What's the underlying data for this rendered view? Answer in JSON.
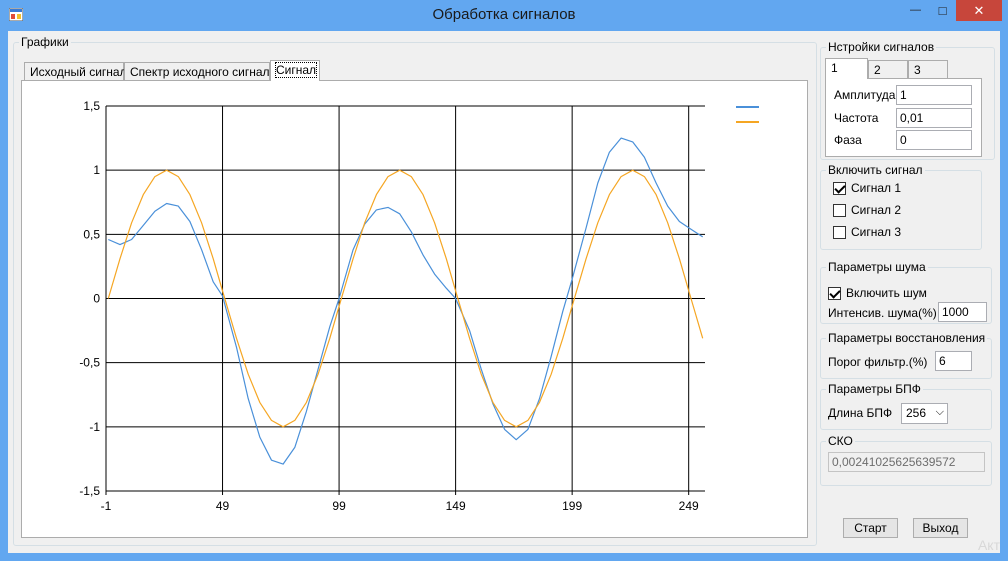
{
  "window": {
    "title": "Обработка сигналов",
    "close_glyph": "✕",
    "minimize_glyph": "—",
    "maximize_glyph": "□"
  },
  "graphs": {
    "group_label": "Графики",
    "tabs": [
      {
        "label": "Исходный сигнал"
      },
      {
        "label": "Спектр исходного сигнала"
      },
      {
        "label": "Сигнал"
      }
    ],
    "active_tab": "Сигнал"
  },
  "signal_settings": {
    "group_label": "Нстройки сигналов",
    "tabs": [
      {
        "label": "1"
      },
      {
        "label": "2"
      },
      {
        "label": "3"
      }
    ],
    "active_tab": "1",
    "amplitude_label": "Амплитуда",
    "amplitude_value": "1",
    "frequency_label": "Частота",
    "frequency_value": "0,01",
    "phase_label": "Фаза",
    "phase_value": "0"
  },
  "enable_signal": {
    "group_label": "Включить сигнал",
    "items": [
      {
        "label": "Сигнал 1",
        "checked": true
      },
      {
        "label": "Сигнал 2",
        "checked": false
      },
      {
        "label": "Сигнал 3",
        "checked": false
      }
    ]
  },
  "noise": {
    "group_label": "Параметры шума",
    "enable_label": "Включить шум",
    "enable_checked": true,
    "intensity_label": "Интенсив. шума(%)",
    "intensity_value": "1000"
  },
  "restore": {
    "group_label": "Параметры восстановления",
    "threshold_label": "Порог фильтр.(%)",
    "threshold_value": "6"
  },
  "fft": {
    "group_label": "Параметры БПФ",
    "length_label": "Длина БПФ",
    "length_value": "256"
  },
  "sko": {
    "group_label": "СКО",
    "value": "0,00241025625639572"
  },
  "buttons": {
    "start": "Старт",
    "exit": "Выход"
  },
  "watermark": "Акт",
  "chart_data": {
    "type": "line",
    "xlim": [
      -1,
      256
    ],
    "ylim": [
      -1.5,
      1.5
    ],
    "x_ticks": [
      -1,
      49,
      99,
      149,
      199,
      249
    ],
    "y_ticks": [
      1.5,
      1,
      0.5,
      0,
      -0.5,
      -1,
      -1.5
    ],
    "y_tick_labels": [
      "1,5",
      "1",
      "0,5",
      "0",
      "-0,5",
      "-1",
      "-1,5"
    ],
    "grid": true,
    "legend_position": "top-right",
    "series": [
      {
        "color": "#4a90d9",
        "x": [
          0,
          5,
          10,
          15,
          20,
          25,
          30,
          35,
          40,
          45,
          49,
          55,
          60,
          65,
          70,
          75,
          80,
          85,
          90,
          95,
          99,
          105,
          110,
          115,
          120,
          125,
          130,
          135,
          140,
          145,
          149,
          155,
          160,
          165,
          170,
          175,
          180,
          185,
          190,
          195,
          199,
          205,
          210,
          215,
          220,
          225,
          230,
          235,
          240,
          245,
          250,
          255
        ],
        "y": [
          0.46,
          0.42,
          0.46,
          0.57,
          0.68,
          0.74,
          0.72,
          0.6,
          0.38,
          0.13,
          0.02,
          -0.38,
          -0.78,
          -1.08,
          -1.26,
          -1.29,
          -1.16,
          -0.88,
          -0.55,
          -0.22,
          0.0,
          0.38,
          0.58,
          0.69,
          0.71,
          0.66,
          0.52,
          0.34,
          0.19,
          0.08,
          0.0,
          -0.25,
          -0.55,
          -0.82,
          -1.02,
          -1.1,
          -1.02,
          -0.78,
          -0.45,
          -0.1,
          0.15,
          0.55,
          0.9,
          1.14,
          1.25,
          1.22,
          1.1,
          0.9,
          0.72,
          0.6,
          0.54,
          0.48
        ]
      },
      {
        "color": "#f5a623",
        "x": [
          0,
          5,
          10,
          15,
          20,
          25,
          30,
          35,
          40,
          45,
          49,
          55,
          60,
          65,
          70,
          75,
          80,
          85,
          90,
          95,
          99,
          105,
          110,
          115,
          120,
          125,
          130,
          135,
          140,
          145,
          149,
          155,
          160,
          165,
          170,
          175,
          180,
          185,
          190,
          195,
          199,
          205,
          210,
          215,
          220,
          225,
          230,
          235,
          240,
          245,
          250,
          255
        ],
        "y": [
          0.0,
          0.31,
          0.59,
          0.81,
          0.95,
          1.0,
          0.95,
          0.81,
          0.59,
          0.31,
          0.06,
          -0.31,
          -0.59,
          -0.81,
          -0.95,
          -1.0,
          -0.95,
          -0.81,
          -0.59,
          -0.31,
          -0.06,
          0.31,
          0.59,
          0.81,
          0.95,
          1.0,
          0.95,
          0.81,
          0.59,
          0.31,
          0.06,
          -0.31,
          -0.59,
          -0.81,
          -0.95,
          -1.0,
          -0.95,
          -0.81,
          -0.59,
          -0.31,
          -0.06,
          0.31,
          0.59,
          0.81,
          0.95,
          1.0,
          0.95,
          0.81,
          0.59,
          0.31,
          0.0,
          -0.31
        ]
      }
    ]
  }
}
